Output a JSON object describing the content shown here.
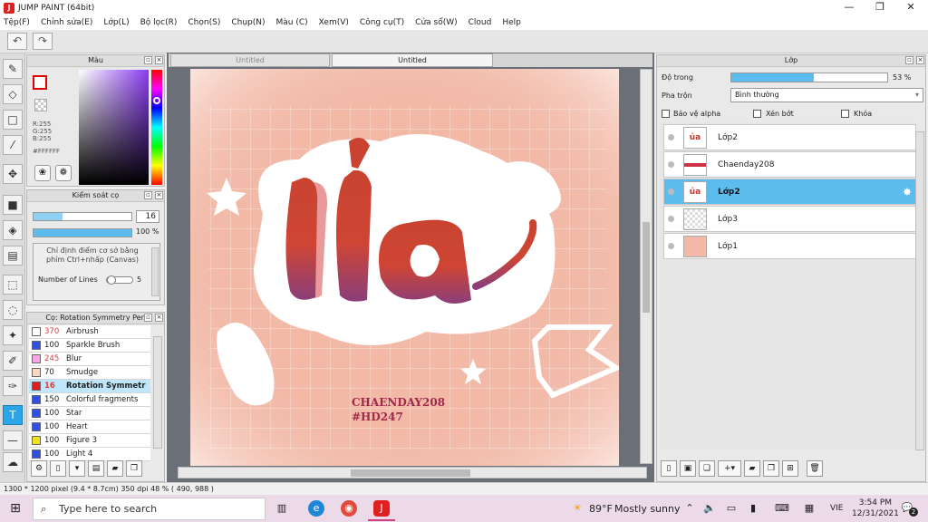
{
  "window": {
    "title": "JUMP PAINT (64bit)",
    "minimize": "—",
    "restore": "❐",
    "close": "✕"
  },
  "menu": [
    "Tệp(F)",
    "Chỉnh sửa(E)",
    "Lớp(L)",
    "Bộ lọc(R)",
    "Chọn(S)",
    "Chụp(N)",
    "Màu (C)",
    "Xem(V)",
    "Công cụ(T)",
    "Cửa sổ(W)",
    "Cloud",
    "Help"
  ],
  "toolbar": {
    "undo": "↶",
    "redo": "↷"
  },
  "color_panel": {
    "title": "Màu",
    "r": "R:255",
    "g": "G:255",
    "b": "B:255",
    "hex": "#FFFFFF"
  },
  "brush_control": {
    "title": "Kiểm soát cọ",
    "size": "16",
    "opacity": "100 %",
    "hint": "Chỉ định điểm cơ sở bằng phím Ctrl+nhấp (Canvas)",
    "lines_label": "Number of Lines",
    "lines_value": "5",
    "size_fill": 0.3,
    "opacity_fill": 1.0
  },
  "brush_list": {
    "title": "Cọ: Rotation Symmetry Pen",
    "items": [
      {
        "num": "370",
        "name": "Airbrush",
        "color": "#ffffff",
        "numcolor": "#d04040"
      },
      {
        "num": "100",
        "name": "Sparkle Brush",
        "color": "#3050e0",
        "numcolor": "#222"
      },
      {
        "num": "245",
        "name": "Blur",
        "color": "#f4a6e6",
        "numcolor": "#d04040"
      },
      {
        "num": "70",
        "name": "Smudge",
        "color": "#f8d8c0",
        "numcolor": "#222"
      },
      {
        "num": "16",
        "name": "Rotation Symmetr",
        "color": "#e02020",
        "numcolor": "#d04040"
      },
      {
        "num": "150",
        "name": "Colorful fragments",
        "color": "#3050e0",
        "numcolor": "#222"
      },
      {
        "num": "100",
        "name": "Star",
        "color": "#3050e0",
        "numcolor": "#222"
      },
      {
        "num": "100",
        "name": "Heart",
        "color": "#3050e0",
        "numcolor": "#222"
      },
      {
        "num": "100",
        "name": "Figure 3",
        "color": "#f0e020",
        "numcolor": "#222"
      },
      {
        "num": "100",
        "name": "Light 4",
        "color": "#3050e0",
        "numcolor": "#222"
      }
    ]
  },
  "tabs": [
    "Untitled",
    "Untitled"
  ],
  "artwork": {
    "main_text": "ủa",
    "credit1": "CHAENDAY208",
    "credit2": "#HD247"
  },
  "layer_panel": {
    "title": "Lớp",
    "opacity_label": "Độ trong",
    "opacity_value": "53 %",
    "opacity_fill": 0.53,
    "blend_label": "Pha trộn",
    "blend_value": "Bình thường",
    "alpha_protect": "Bảo vệ alpha",
    "clip": "Xén bớt",
    "lock": "Khóa",
    "layers": [
      {
        "name": "Lớp2",
        "thumb": "ủa",
        "selected": false
      },
      {
        "name": "Chaenday208",
        "thumb": "",
        "selected": false
      },
      {
        "name": "Lớp2",
        "thumb": "ủa",
        "selected": true
      },
      {
        "name": "Lớp3",
        "thumb": "",
        "selected": false
      },
      {
        "name": "Lớp1",
        "thumb": "",
        "selected": false
      }
    ]
  },
  "status": "1300 * 1200 pixel   (9.4 * 8.7cm)   350 dpi   48 %   ( 490, 988 )",
  "taskbar": {
    "search_placeholder": "Type here to search",
    "weather_temp": "89°F",
    "weather_text": "Mostly sunny",
    "lang": "VIE",
    "time": "3:54 PM",
    "date": "12/31/2021",
    "notif": "2"
  }
}
